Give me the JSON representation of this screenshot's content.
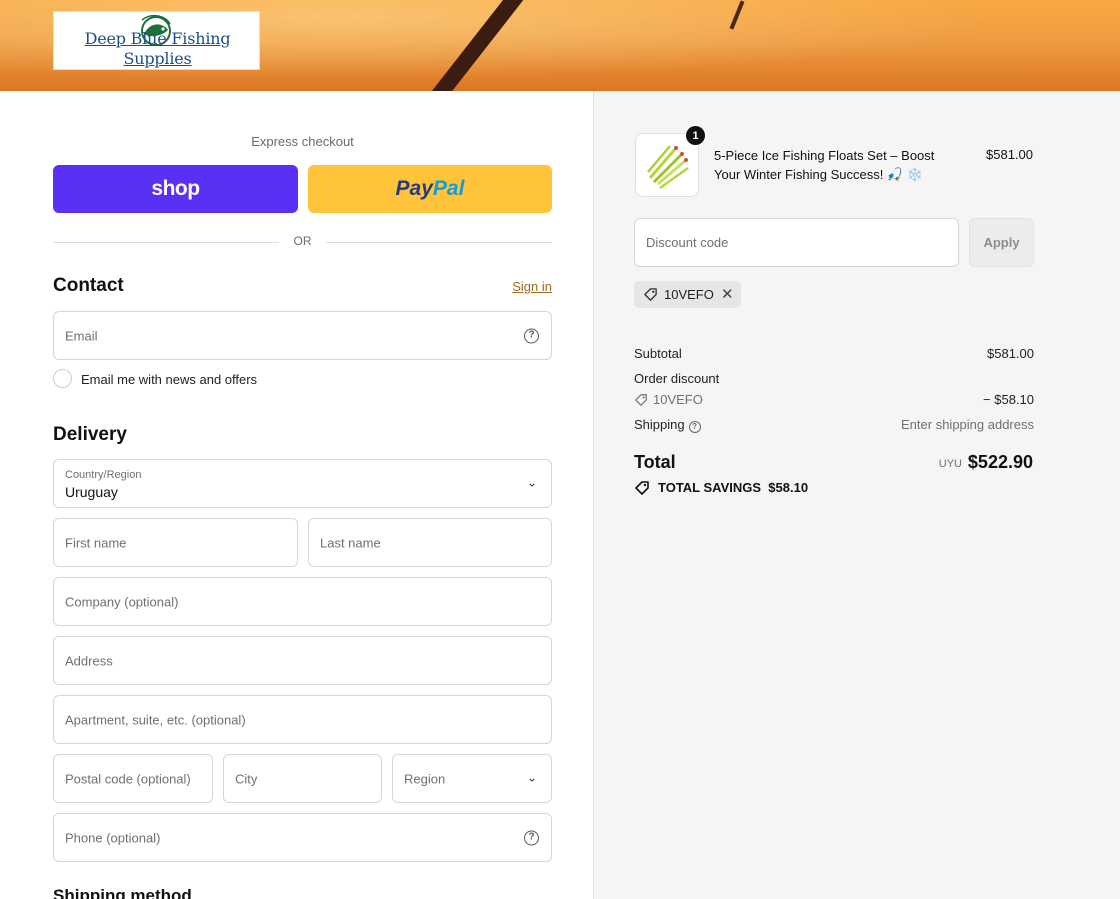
{
  "header": {
    "store_name": "Deep Blue Fishing Supplies"
  },
  "express": {
    "title": "Express checkout",
    "shop_label": "shop",
    "paypal_label_a": "Pay",
    "paypal_label_b": "Pal",
    "or_label": "OR"
  },
  "contact": {
    "title": "Contact",
    "sign_in": "Sign in",
    "email_placeholder": "Email",
    "newsletter_label": "Email me with news and offers"
  },
  "delivery": {
    "title": "Delivery",
    "country_label": "Country/Region",
    "country_value": "Uruguay",
    "first_name": "First name",
    "last_name": "Last name",
    "company": "Company (optional)",
    "address": "Address",
    "apartment": "Apartment, suite, etc. (optional)",
    "postal": "Postal code (optional)",
    "city": "City",
    "region": "Region",
    "phone": "Phone (optional)"
  },
  "shipping_method": {
    "title": "Shipping method"
  },
  "cart": {
    "item": {
      "name": "5-Piece Ice Fishing Floats Set – Boost Your Winter Fishing Success! 🎣 ❄️",
      "price": "$581.00",
      "quantity": "1"
    },
    "discount_placeholder": "Discount code",
    "apply_label": "Apply",
    "applied_code": "10VEFO"
  },
  "summary": {
    "subtotal_label": "Subtotal",
    "subtotal_value": "$581.00",
    "order_discount_label": "Order discount",
    "discount_code": "10VEFO",
    "discount_value": "− $58.10",
    "shipping_label": "Shipping",
    "shipping_value": "Enter shipping address",
    "total_label": "Total",
    "currency": "UYU",
    "total_value": "$522.90",
    "savings_label": "TOTAL SAVINGS",
    "savings_value": "$58.10"
  },
  "colors": {
    "shop_button": "#5a31f4",
    "paypal_button": "#ffc439",
    "banner": "#f2a040",
    "link": "#9a6b1f"
  }
}
